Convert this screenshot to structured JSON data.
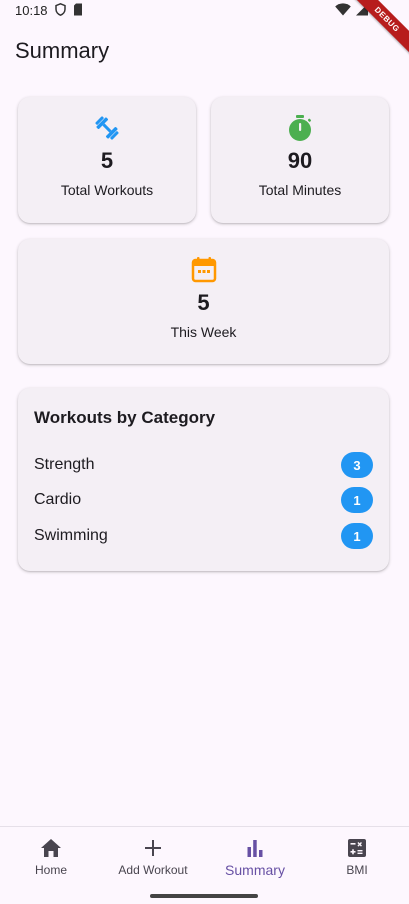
{
  "status_bar": {
    "time": "10:18",
    "debug_label": "DEBUG"
  },
  "header": {
    "title": "Summary"
  },
  "stats": {
    "total_workouts": {
      "value": "5",
      "label": "Total Workouts",
      "icon": "dumbbell-icon",
      "color": "#2196f3"
    },
    "total_minutes": {
      "value": "90",
      "label": "Total Minutes",
      "icon": "timer-icon",
      "color": "#4caf50"
    },
    "this_week": {
      "value": "5",
      "label": "This Week",
      "icon": "calendar-icon",
      "color": "#ff9800"
    }
  },
  "categories": {
    "title": "Workouts by Category",
    "items": [
      {
        "name": "Strength",
        "count": "3"
      },
      {
        "name": "Cardio",
        "count": "1"
      },
      {
        "name": "Swimming",
        "count": "1"
      }
    ],
    "badge_color": "#2196f3"
  },
  "nav": {
    "items": [
      {
        "label": "Home",
        "icon": "home-icon"
      },
      {
        "label": "Add Workout",
        "icon": "plus-icon"
      },
      {
        "label": "Summary",
        "icon": "bar-chart-icon",
        "active": true
      },
      {
        "label": "BMI",
        "icon": "calculator-icon"
      }
    ],
    "active_color": "#6750a4"
  }
}
